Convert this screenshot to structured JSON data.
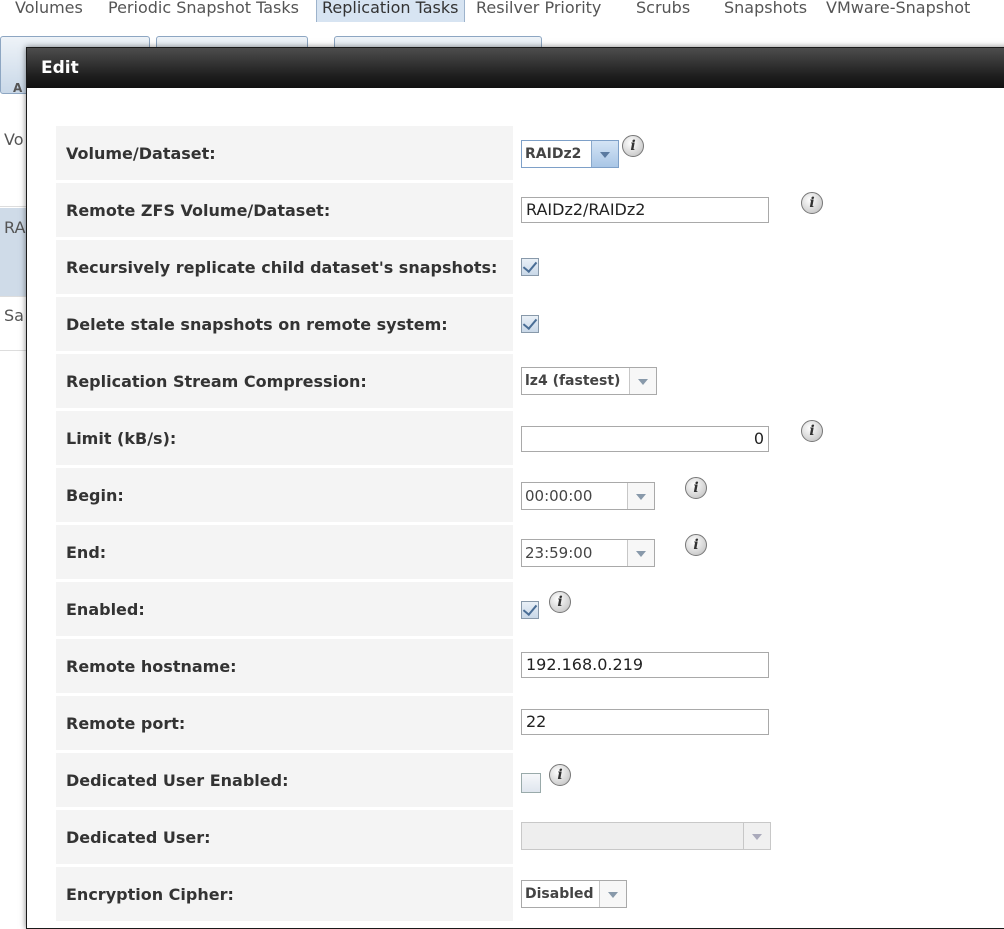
{
  "app_tabs": [
    {
      "label": "Volumes"
    },
    {
      "label": "Periodic Snapshot Tasks"
    },
    {
      "label": "Replication Tasks"
    },
    {
      "label": "Resilver Priority"
    },
    {
      "label": "Scrubs"
    },
    {
      "label": "Snapshots"
    },
    {
      "label": "VMware-Snapshot"
    }
  ],
  "background_page": {
    "button_fragment": "A",
    "rows": [
      {
        "text": "Vo"
      },
      {
        "text": "RA"
      },
      {
        "text": "Sa"
      }
    ]
  },
  "dialog": {
    "title": "Edit",
    "close_glyph": "✕",
    "info_glyph": "i",
    "fields": {
      "volume_dataset": {
        "label": "Volume/Dataset:",
        "value": "RAIDz2"
      },
      "remote_dataset": {
        "label": "Remote ZFS Volume/Dataset:",
        "value": "RAIDz2/RAIDz2"
      },
      "recursive": {
        "label": "Recursively replicate child dataset's snapshots:",
        "checked": true
      },
      "delete_stale": {
        "label": "Delete stale snapshots on remote system:",
        "checked": true
      },
      "compression": {
        "label": "Replication Stream Compression:",
        "value": "lz4 (fastest)"
      },
      "limit": {
        "label": "Limit (kB/s):",
        "value": "0"
      },
      "begin": {
        "label": "Begin:",
        "value": "00:00:00"
      },
      "end": {
        "label": "End:",
        "value": "23:59:00"
      },
      "enabled": {
        "label": "Enabled:",
        "checked": true
      },
      "remote_hostname": {
        "label": "Remote hostname:",
        "value": "192.168.0.219"
      },
      "remote_port": {
        "label": "Remote port:",
        "value": "22"
      },
      "dedicated_user_enabled": {
        "label": "Dedicated User Enabled:",
        "checked": false
      },
      "dedicated_user": {
        "label": "Dedicated User:",
        "value": ""
      },
      "encryption_cipher": {
        "label": "Encryption Cipher:",
        "value": "Disabled"
      }
    }
  },
  "colors": {
    "titlebar": "#1e1e1e",
    "label_bg": "#f4f4f4",
    "active_tab": "#d7e4f2",
    "check": "#4a6e96"
  }
}
